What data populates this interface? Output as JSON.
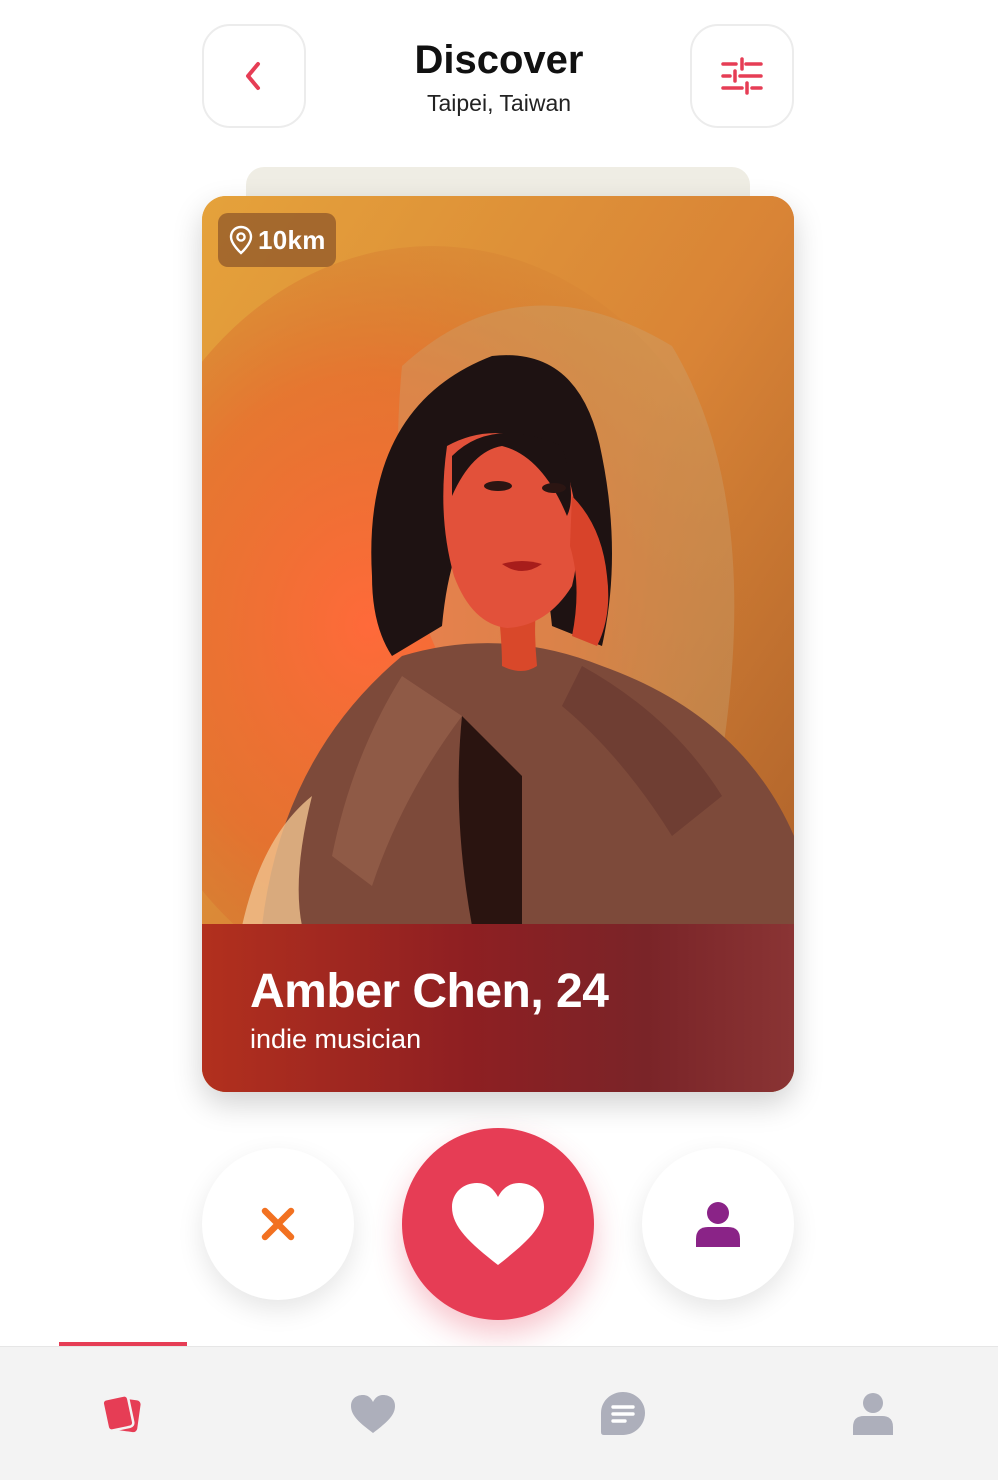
{
  "header": {
    "title": "Discover",
    "location": "Taipei, Taiwan",
    "back_icon": "chevron-left-icon",
    "filter_icon": "sliders-icon"
  },
  "card": {
    "distance": "10km",
    "name_age": "Amber Chen, 24",
    "occupation": "indie musician"
  },
  "actions": {
    "dislike_icon": "close-icon",
    "like_icon": "heart-icon",
    "profile_icon": "user-icon"
  },
  "tabbar": {
    "active": "cards",
    "tabs": [
      {
        "id": "cards",
        "icon": "cards-icon"
      },
      {
        "id": "likes",
        "icon": "heart-icon"
      },
      {
        "id": "chat",
        "icon": "chat-icon"
      },
      {
        "id": "profile",
        "icon": "user-icon"
      }
    ]
  },
  "colors": {
    "accent": "#e63d55",
    "dislike": "#f27121",
    "profile": "#8a2387",
    "inactive": "#adafbb"
  }
}
